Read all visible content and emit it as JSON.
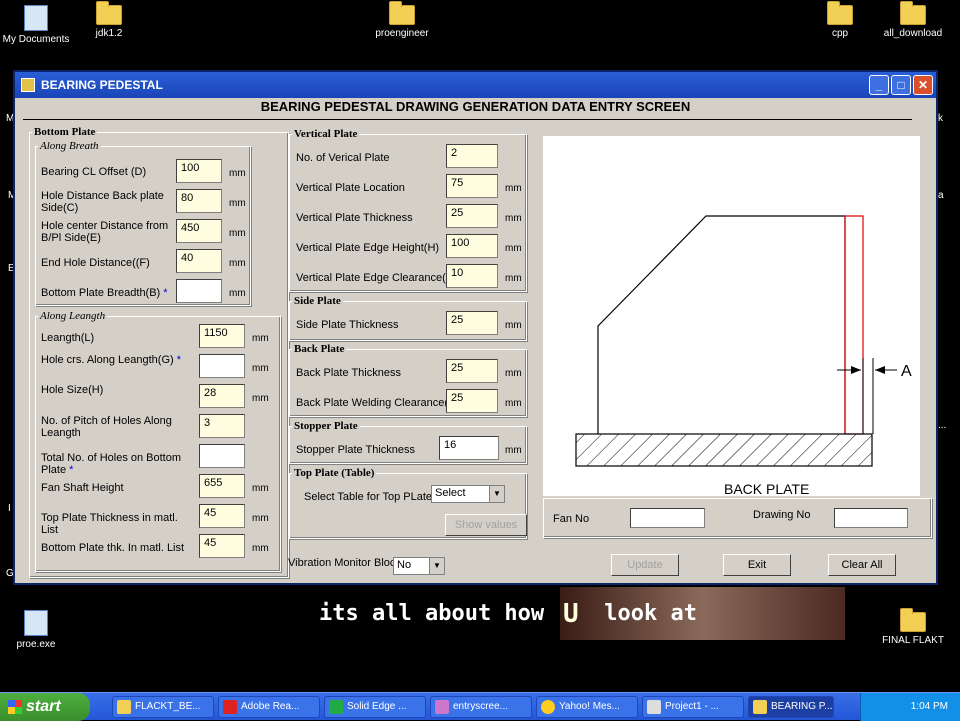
{
  "desktop": {
    "icons": [
      {
        "label": "My Documents"
      },
      {
        "label": "jdk1.2"
      },
      {
        "label": "proengineer"
      },
      {
        "label": "cpp"
      },
      {
        "label": "all_download"
      },
      {
        "label": "proe.exe"
      },
      {
        "label": "FINAL FLAKT"
      }
    ],
    "edge_glyphs": [
      "M",
      "M",
      "I",
      "E",
      "G",
      "k",
      "a",
      "..."
    ]
  },
  "window": {
    "title": "BEARING PEDESTAL",
    "heading": "BEARING PEDESTAL DRAWING GENERATION  DATA ENTRY SCREEN",
    "title_buttons": {
      "minimize": "_",
      "maximize": "□",
      "close": "✕"
    }
  },
  "bottom_plate": {
    "legend": "Bottom Plate",
    "breath": {
      "legend": "Along Breath",
      "fields": [
        {
          "label": "Bearing CL Offset (D)",
          "value": "100",
          "unit": "mm"
        },
        {
          "label": "Hole Distance Back plate Side(C)",
          "value": "80",
          "unit": "mm"
        },
        {
          "label": "Hole center  Distance from B/Pl Side(E)",
          "value": "450",
          "unit": "mm"
        },
        {
          "label": "End Hole Distance((F)",
          "value": "40",
          "unit": "mm"
        },
        {
          "label": "Bottom Plate Breadth(B)",
          "star": "*",
          "value": "",
          "unit": "mm"
        }
      ]
    },
    "length": {
      "legend": "Along Leangth",
      "fields": [
        {
          "label": "Leangth(L)",
          "value": "1150",
          "unit": "mm"
        },
        {
          "label": "Hole crs. Along Leangth(G)",
          "star": "*",
          "value": "",
          "unit": "mm"
        },
        {
          "label": "Hole Size(H)",
          "value": "28",
          "unit": "mm"
        },
        {
          "label": "No. of Pitch of Holes Along Leangth",
          "value": "3",
          "unit": ""
        },
        {
          "label": "Total No. of Holes on Bottom Plate",
          "star": "*",
          "value": "",
          "unit": ""
        },
        {
          "label": "Fan Shaft Height",
          "value": "655",
          "unit": "mm"
        },
        {
          "label": "Top Plate Thickness in matl. List",
          "value": "45",
          "unit": "mm"
        },
        {
          "label": "Bottom Plate thk. In matl. List",
          "value": "45",
          "unit": "mm"
        }
      ]
    }
  },
  "vertical_plate": {
    "legend": "Vertical Plate",
    "fields": [
      {
        "label": "No. of Verical Plate",
        "value": "2",
        "unit": ""
      },
      {
        "label": "Vertical Plate Location",
        "value": "75",
        "unit": "mm"
      },
      {
        "label": "Vertical Plate Thickness",
        "value": "25",
        "unit": "mm"
      },
      {
        "label": "Vertical Plate Edge Height(H)",
        "value": "100",
        "unit": "mm"
      },
      {
        "label": "Vertical Plate Edge Clearance(L)",
        "value": "10",
        "unit": "mm"
      }
    ]
  },
  "side_plate": {
    "legend": "Side Plate",
    "fields": [
      {
        "label": "Side Plate Thickness",
        "value": "25",
        "unit": "mm"
      }
    ]
  },
  "back_plate": {
    "legend": "Back Plate",
    "fields": [
      {
        "label": "Back Plate Thickness",
        "value": "25",
        "unit": "mm"
      },
      {
        "label": "Back Plate Welding Clearance(A)",
        "value": "25",
        "unit": "mm"
      }
    ]
  },
  "stopper_plate": {
    "legend": "Stopper Plate",
    "fields": [
      {
        "label": "Stopper Plate Thickness",
        "value": "16",
        "unit": "mm"
      }
    ]
  },
  "top_plate": {
    "legend": "Top Plate (Table)",
    "select_label": "Select Table for Top PLate",
    "select_value": "Select",
    "show_values": "Show values"
  },
  "vibration": {
    "label": "Vibration Monitor Block",
    "value": "No"
  },
  "preview": {
    "caption": "BACK PLATE",
    "dim_label": "A"
  },
  "fan_no": {
    "label": "Fan No",
    "value": ""
  },
  "drawing_no": {
    "label": "Drawing No",
    "value": ""
  },
  "buttons": {
    "update": "Update",
    "exit": "Exit",
    "clear_all": "Clear All"
  },
  "banner": {
    "part1": "its all about how ",
    "part2": "U",
    "part3": " look at"
  },
  "taskbar": {
    "start": "start",
    "tasks": [
      "FLACKT_BE...",
      "Adobe Rea...",
      "Solid Edge ...",
      "entryscree...",
      "Yahoo! Mes...",
      "Project1 - ...",
      "BEARING P..."
    ],
    "clock": "1:04 PM"
  }
}
